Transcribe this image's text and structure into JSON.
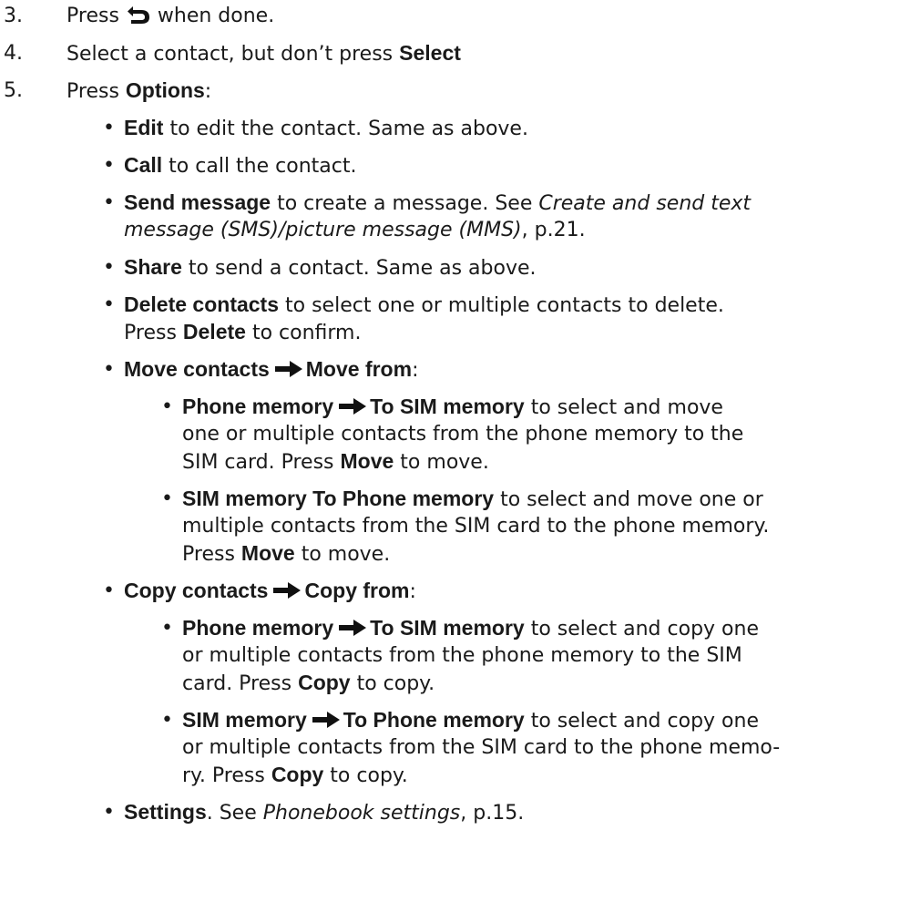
{
  "steps": [
    {
      "num": "3.",
      "pre": "Press ",
      "post": " when done."
    },
    {
      "num": "4.",
      "pre": "Select a contact, but don’t press ",
      "bold": "Select"
    },
    {
      "num": "5.",
      "pre": "Press ",
      "bold": "Options",
      "post": ":"
    }
  ],
  "bullet": "•",
  "options": {
    "edit": {
      "bold": "Edit",
      "text": " to edit the contact. Same as above."
    },
    "call": {
      "bold": "Call",
      "text": " to call the contact."
    },
    "send": {
      "bold": "Send message",
      "text": " to create a message. See ",
      "ref": "Create and send text",
      "ref2": "message (SMS)/picture message (MMS)",
      "page": ", p.21."
    },
    "share": {
      "bold": "Share",
      "text": " to send a contact. Same as above."
    },
    "delete": {
      "bold": "Delete contacts",
      "text": " to select one or multiple contacts to delete.",
      "line2_pre": "Press ",
      "line2_bold": "Delete",
      "line2_post": " to confirm."
    },
    "move": {
      "bold_a": "Move contacts",
      "bold_b": "Move from",
      "post": ":"
    },
    "move_phone": {
      "bold_a": "Phone memory",
      "bold_b": "To SIM memory",
      "text": " to select and move",
      "line2": "one or multiple contacts from the phone memory to the",
      "line3_pre": "SIM card. Press ",
      "line3_bold": "Move",
      "line3_post": " to move."
    },
    "move_sim": {
      "bold": "SIM memory To Phone memory",
      "text": " to select and move one or",
      "line2": "multiple contacts from the SIM card to the phone memory.",
      "line3_pre": "Press ",
      "line3_bold": "Move",
      "line3_post": " to move."
    },
    "copy": {
      "bold_a": "Copy contacts",
      "bold_b": "Copy from",
      "post": ":"
    },
    "copy_phone": {
      "bold_a": "Phone memory",
      "bold_b": "To SIM memory",
      "text": " to select and copy one",
      "line2": "or multiple contacts from the phone memory to the SIM",
      "line3_pre": "card. Press ",
      "line3_bold": "Copy",
      "line3_post": " to copy."
    },
    "copy_sim": {
      "bold_a": "SIM memory",
      "bold_b": "To Phone memory",
      "text": " to select and copy one",
      "line2": "or multiple contacts from the SIM card to the phone memo-",
      "line3_pre": "ry. Press ",
      "line3_bold": "Copy",
      "line3_post": " to copy."
    },
    "settings": {
      "bold": "Settings",
      "text": ". See ",
      "ref": "Phonebook settings",
      "page": ", p.15."
    }
  },
  "icons": {
    "back": "back-icon",
    "arrow": "right-arrow-icon"
  }
}
